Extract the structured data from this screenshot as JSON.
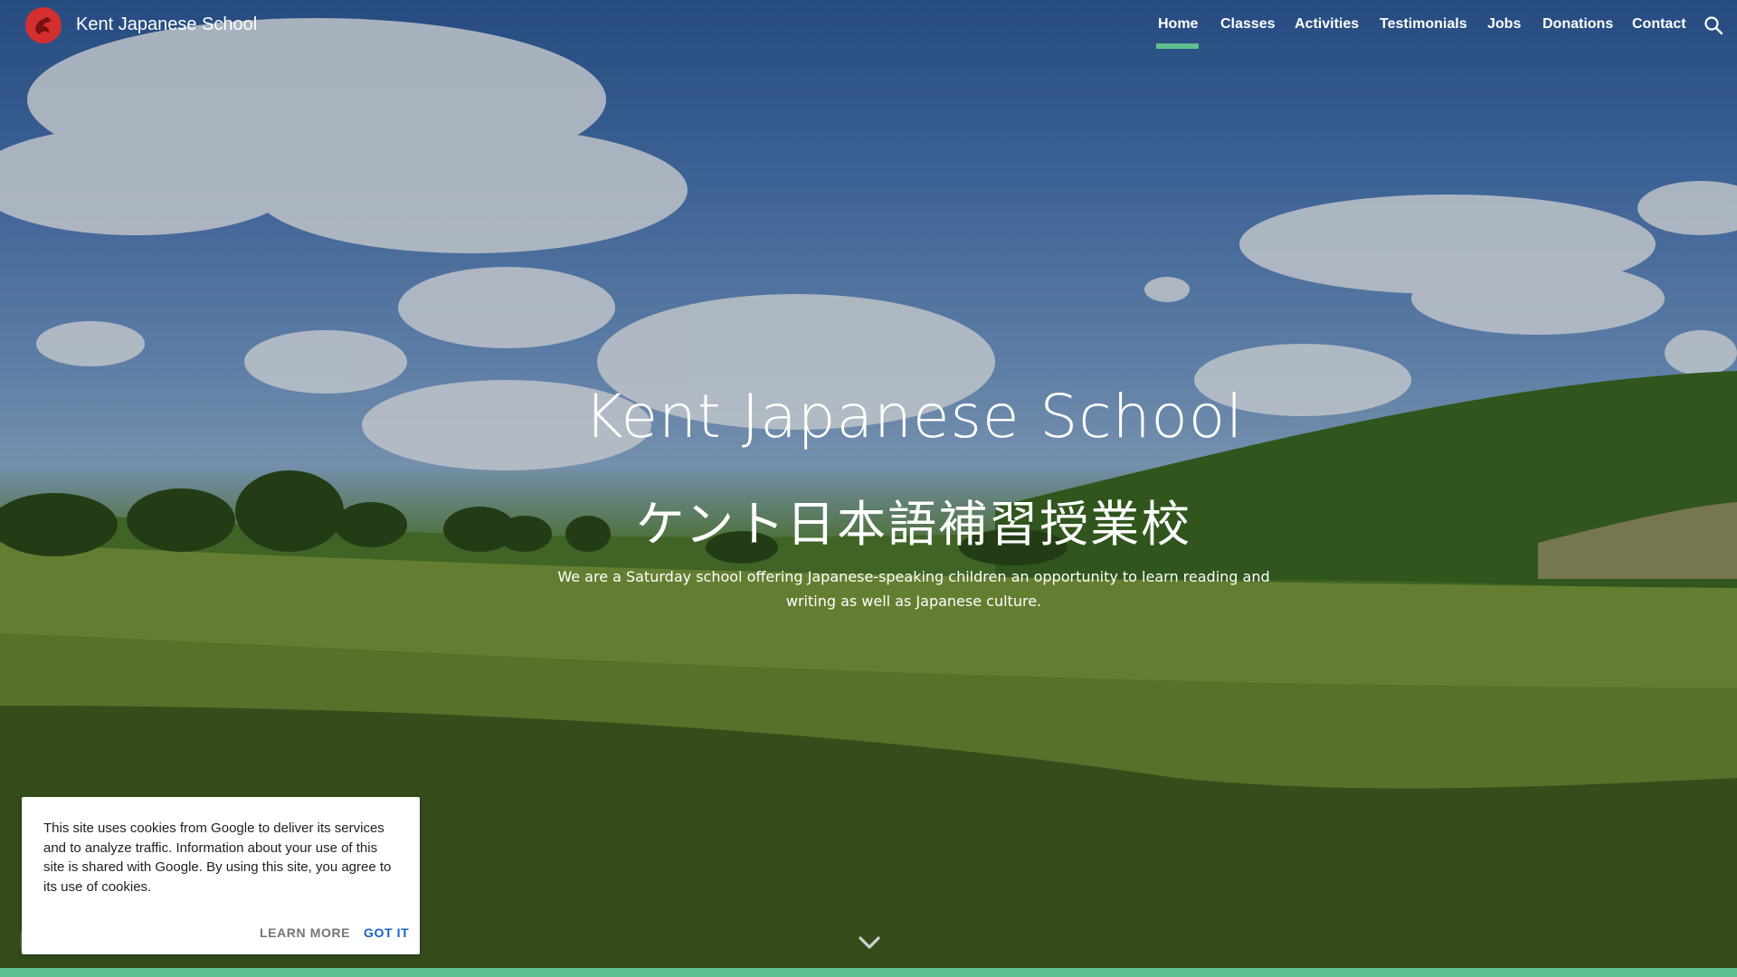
{
  "header": {
    "site_title": "Kent Japanese School",
    "nav": [
      "Home",
      "Classes",
      "Activities",
      "Testimonials",
      "Jobs",
      "Donations",
      "Contact"
    ],
    "active_nav": "Home",
    "search_icon": "search-icon",
    "accent_color": "#5ec08e"
  },
  "hero": {
    "title": "Kent Japanese School",
    "japanese_title": "ケント日本語補習授業校",
    "description": "We are a Saturday school offering Japanese-speaking children an opportunity to learn reading and writing as well as Japanese culture.",
    "scroll_icon": "chevron-down-icon"
  },
  "cookie_notice": {
    "text": "This site uses cookies from Google to deliver its services and to analyze traffic. Information about your use of this site is shared with Google. By using this site, you agree to its use of cookies.",
    "learn_more": "LEARN MORE",
    "got_it": "GOT IT"
  }
}
